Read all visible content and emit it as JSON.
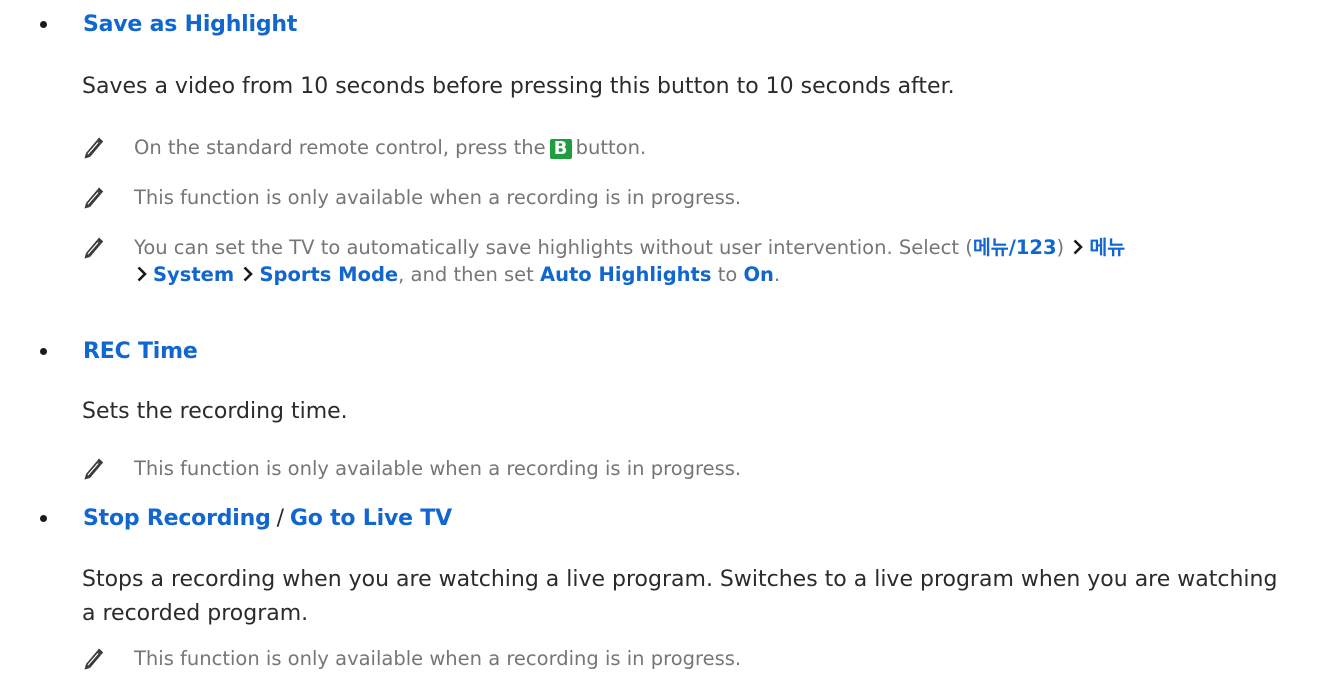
{
  "sections": [
    {
      "title": "Save as Highlight",
      "description": "Saves a video from 10 seconds before pressing this button to 10 seconds after.",
      "notes": [
        {
          "before": "On the standard remote control, press the",
          "key": "B",
          "after": "button."
        },
        {
          "text": "This function is only available when a recording is in progress."
        },
        {
          "p1": "You can set the TV to automatically save highlights without user intervention. Select (",
          "menu_key": "메뉴/123",
          "p2": ")",
          "menu1": "메뉴",
          "menu2": "System",
          "menu3": "Sports Mode",
          "p3": ", and then set",
          "setting": "Auto Highlights",
          "p4": "to",
          "value": "On",
          "p5": "."
        }
      ]
    },
    {
      "title": "REC Time",
      "description": "Sets the recording time.",
      "notes": [
        {
          "text": "This function is only available when a recording is in progress."
        }
      ]
    },
    {
      "title_a": "Stop Recording",
      "title_sep": "/",
      "title_b": "Go to Live TV",
      "description": "Stops a recording when you are watching a live program. Switches to a live program when you are watching a recorded program.",
      "notes": [
        {
          "text": "This function is only available when a recording is in progress."
        }
      ]
    }
  ],
  "icons": {
    "note": "pencil-note-icon",
    "arrow": "chevron-right-icon",
    "key": "b-key-icon"
  },
  "colors": {
    "link": "#1166d0",
    "note_text": "#767676",
    "body_text": "#2b2b2b",
    "key_b": "#1e9e3e"
  }
}
